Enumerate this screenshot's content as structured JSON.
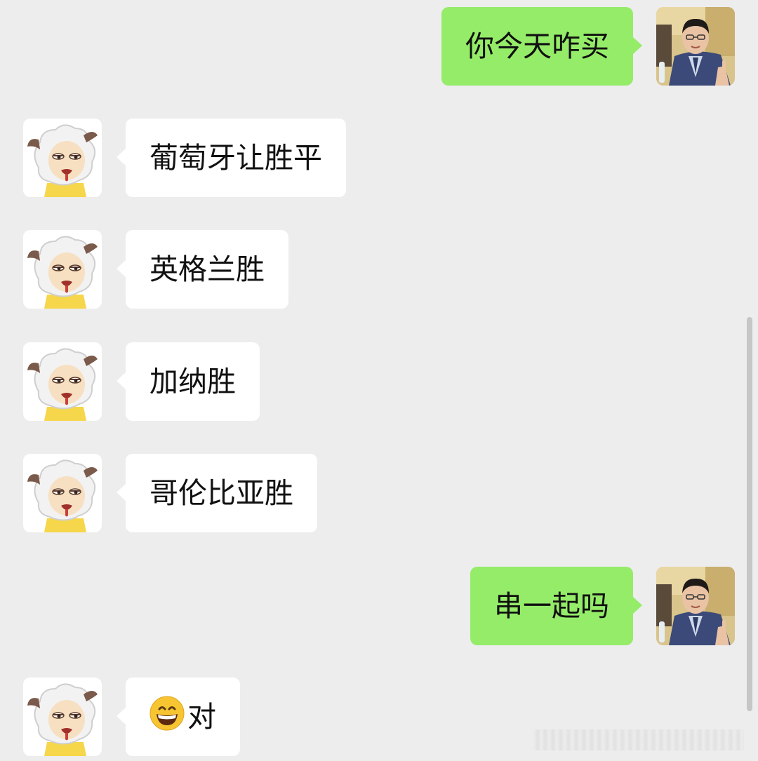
{
  "colors": {
    "background": "#ededed",
    "sent_bubble": "#95ec69",
    "received_bubble": "#ffffff"
  },
  "messages": [
    {
      "side": "right",
      "sender": "man-avatar",
      "text": "你今天咋买"
    },
    {
      "side": "left",
      "sender": "sheep-avatar",
      "text": "葡萄牙让胜平"
    },
    {
      "side": "left",
      "sender": "sheep-avatar",
      "text": "英格兰胜"
    },
    {
      "side": "left",
      "sender": "sheep-avatar",
      "text": "加纳胜"
    },
    {
      "side": "left",
      "sender": "sheep-avatar",
      "text": "哥伦比亚胜"
    },
    {
      "side": "right",
      "sender": "man-avatar",
      "text": "串一起吗"
    },
    {
      "side": "left",
      "sender": "sheep-avatar",
      "emoji": "grinning-face-emoji",
      "text": "对"
    }
  ]
}
